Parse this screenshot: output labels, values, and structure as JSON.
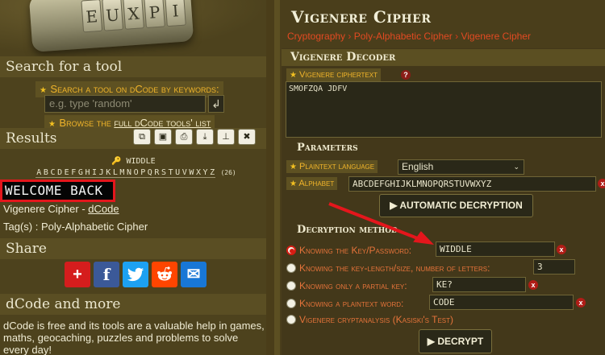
{
  "sidebar": {
    "hero_letters": [
      "E",
      "U",
      "X",
      "P",
      "I"
    ],
    "search_title": "Search for a tool",
    "search_link": "Search a tool on dCode by keywords:",
    "search_placeholder": "e.g. type 'random'",
    "enter_glyph": "↲",
    "browse_prefix": "Browse the ",
    "browse_link": "full dCode tools' list",
    "results_title": "Results",
    "result_key_icon": "🔑",
    "result_key": "WIDDLE",
    "alphabet_letters": [
      "A",
      "B",
      "C",
      "D",
      "E",
      "F",
      "G",
      "H",
      "I",
      "J",
      "K",
      "L",
      "M",
      "N",
      "O",
      "P",
      "Q",
      "R",
      "S",
      "T",
      "U",
      "V",
      "W",
      "X",
      "Y",
      "Z"
    ],
    "alphabet_count": "(26)",
    "result_text": "WELCOME BACK",
    "cipher_name": "Vigenere Cipher - ",
    "cipher_site": "dCode",
    "tags": "Tag(s) : Poly-Alphabetic Cipher",
    "share_title": "Share",
    "more_title": "dCode and more",
    "more_text": "dCode is free and its tools are a valuable help in games, maths, geocaching, puzzles and problems to solve every day!"
  },
  "toolbar_icons": [
    "copy-icon",
    "save-icon",
    "print-icon",
    "download-icon",
    "pin-icon",
    "close-icon"
  ],
  "toolbar_glyphs": [
    "⧉",
    "▣",
    "⎙",
    "⤓",
    "⊥",
    "✖"
  ],
  "share_buttons": [
    {
      "name": "share-plus-button",
      "glyph": "+",
      "color": "#d51d1d"
    },
    {
      "name": "share-facebook-button",
      "glyph": "f",
      "color": "#3b5998"
    },
    {
      "name": "share-twitter-button",
      "glyph": "t",
      "color": "#1da1f2"
    },
    {
      "name": "share-reddit-button",
      "glyph": "r",
      "color": "#ff4500"
    },
    {
      "name": "share-email-button",
      "glyph": "✉",
      "color": "#1877d6"
    }
  ],
  "main": {
    "title": "Vigenere Cipher",
    "breadcrumbs": [
      "Cryptography",
      "Poly-Alphabetic Cipher",
      "Vigenere Cipher"
    ],
    "breadcrumb_sep": " › ",
    "decoder_title": "Vigenere Decoder",
    "ciphertext_label": "Vigenere ciphertext",
    "ciphertext_value": "SMOFZQA JDFV",
    "params_title": "Parameters",
    "plaintext_lang_label": "Plaintext language",
    "plaintext_lang_value": "English",
    "alphabet_label": "Alphabet",
    "alphabet_value": "ABCDEFGHIJKLMNOPQRSTUVWXYZ",
    "auto_button": "▶ AUTOMATIC DECRYPTION",
    "method_title": "Decryption method",
    "methods": [
      {
        "label": "Knowing the Key/Password:",
        "value": "WIDDLE",
        "selected": true
      },
      {
        "label": "Knowing the key-length/size, number of letters:",
        "value": "3",
        "selected": false
      },
      {
        "label": "Knowing only a partial key:",
        "value": "KE?",
        "selected": false
      },
      {
        "label": "Knowing a plaintext word:",
        "value": "CODE",
        "selected": false
      },
      {
        "label": "Vigenere cryptanalysis (Kasiski's Test)",
        "value": "",
        "selected": false
      }
    ],
    "decrypt_button": "▶ DECRYPT"
  },
  "colors": {
    "annotation_arrow": "#e4161c",
    "link_yellow": "#f0b42a",
    "breadcrumb_red": "#d83a1c"
  }
}
